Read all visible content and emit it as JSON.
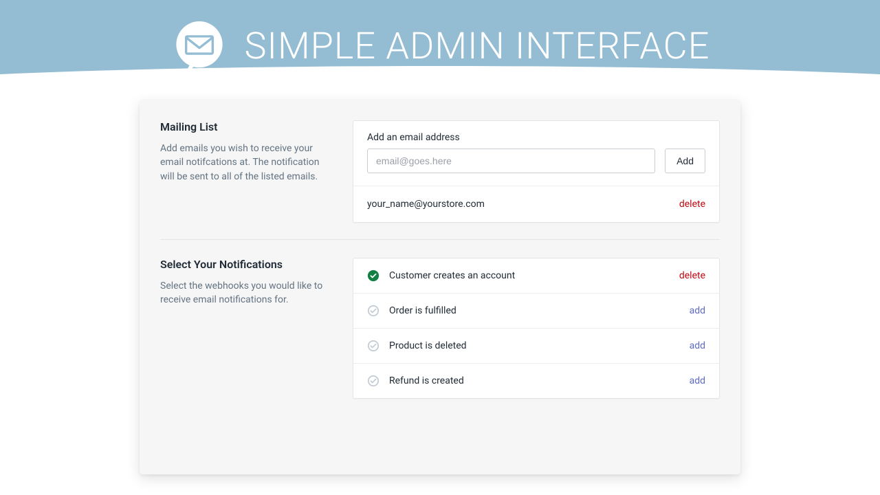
{
  "hero": {
    "title": "SIMPLE ADMIN INTERFACE"
  },
  "mailing": {
    "title": "Mailing List",
    "description": "Add emails you wish to receive your email notifcations at. The notification will be sent to all of the listed emails.",
    "field_label": "Add an email address",
    "placeholder": "email@goes.here",
    "add_button": "Add",
    "emails": [
      {
        "address": "your_name@yourstore.com",
        "action": "delete"
      }
    ]
  },
  "notifications": {
    "title": "Select Your Notifications",
    "description": "Select the webhooks you would like to receive email notifications for.",
    "items": [
      {
        "label": "Customer creates an account",
        "active": true,
        "action": "delete"
      },
      {
        "label": "Order is fulfilled",
        "active": false,
        "action": "add"
      },
      {
        "label": "Product is deleted",
        "active": false,
        "action": "add"
      },
      {
        "label": "Refund is created",
        "active": false,
        "action": "add"
      }
    ]
  },
  "colors": {
    "hero_bg": "#94bdd4",
    "delete": "#bf0711",
    "add": "#5c6ac4",
    "active_green": "#108043"
  }
}
